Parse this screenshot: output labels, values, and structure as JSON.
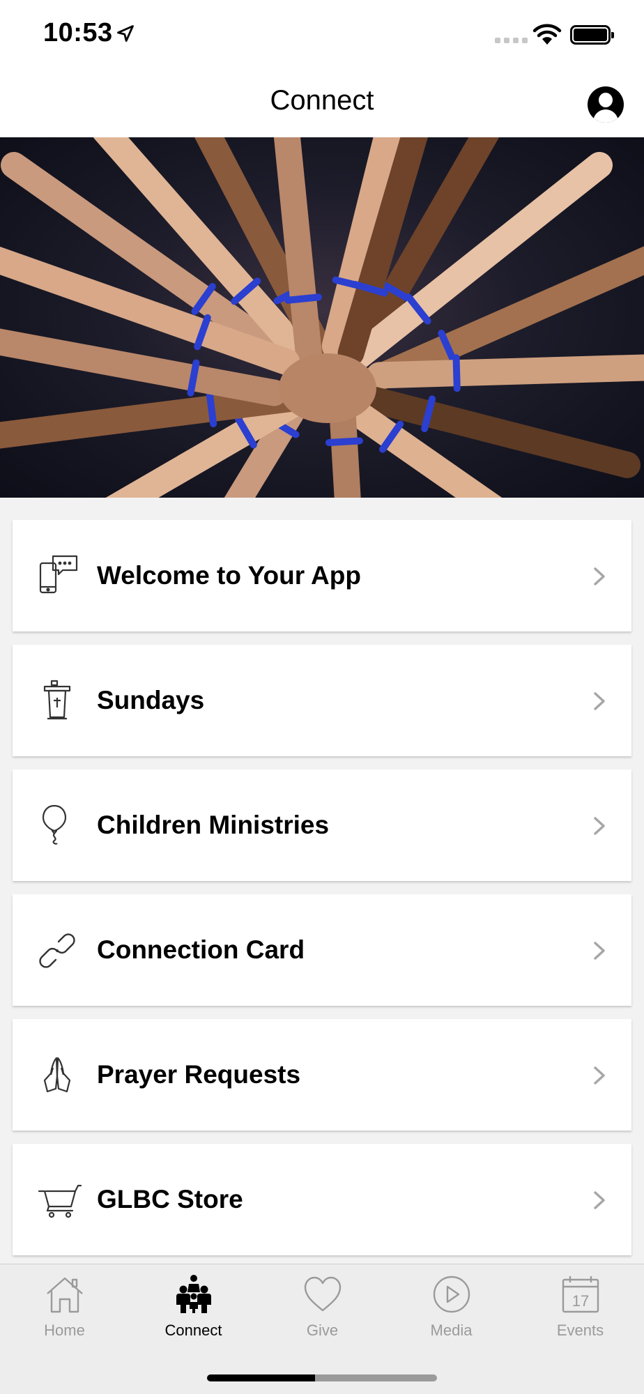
{
  "status_bar": {
    "time": "10:53",
    "icons": [
      "location-arrow-icon",
      "cellular-signal-icon",
      "wifi-icon",
      "battery-icon"
    ]
  },
  "header": {
    "title": "Connect",
    "profile_icon": "profile-icon"
  },
  "hero": {
    "image": "hands-stacked-in-circle-photo"
  },
  "menu": {
    "items": [
      {
        "label": "Welcome to Your App",
        "icon": "phone-chat-icon"
      },
      {
        "label": "Sundays",
        "icon": "pulpit-icon"
      },
      {
        "label": "Children Ministries",
        "icon": "balloon-icon"
      },
      {
        "label": "Connection Card",
        "icon": "link-icon"
      },
      {
        "label": "Prayer Requests",
        "icon": "praying-hands-icon"
      },
      {
        "label": "GLBC Store",
        "icon": "shopping-cart-icon"
      }
    ],
    "chevron_icon": "chevron-right-icon"
  },
  "tab_bar": {
    "tabs": [
      {
        "label": "Home",
        "icon": "home-icon",
        "active": false
      },
      {
        "label": "Connect",
        "icon": "people-icon",
        "active": true
      },
      {
        "label": "Give",
        "icon": "heart-icon",
        "active": false
      },
      {
        "label": "Media",
        "icon": "play-icon",
        "active": false
      },
      {
        "label": "Events",
        "icon": "calendar-icon",
        "active": false,
        "calendar_day": "17"
      }
    ]
  },
  "colors": {
    "background": "#f2f2f2",
    "card": "#ffffff",
    "tab_inactive": "#9a9a9a",
    "tab_active": "#000000",
    "chevron": "#a6a6a6",
    "wristband": "#2b3fd0"
  }
}
